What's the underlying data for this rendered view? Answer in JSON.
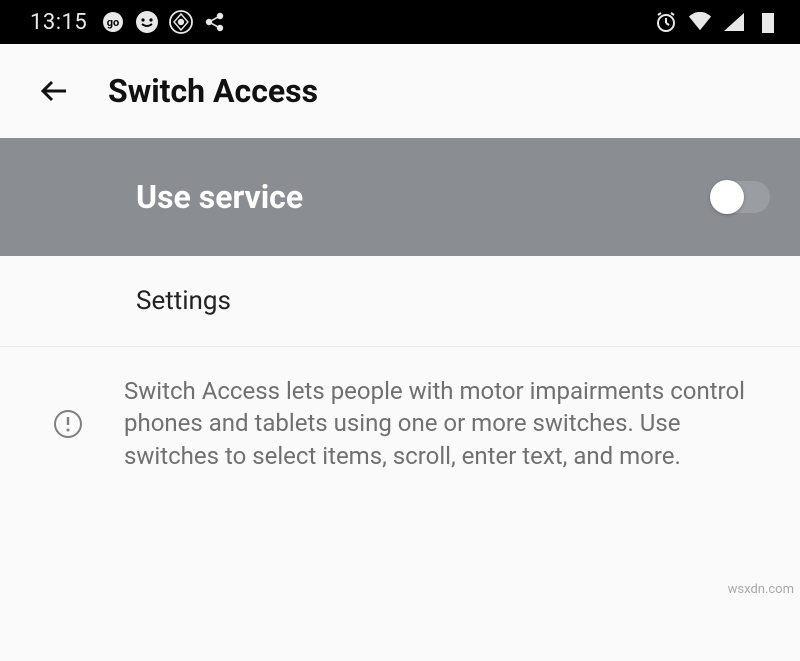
{
  "status_bar": {
    "time": "13:15"
  },
  "header": {
    "title": "Switch Access"
  },
  "use_service": {
    "label": "Use service",
    "enabled": false
  },
  "settings": {
    "label": "Settings"
  },
  "info": {
    "text": "Switch Access lets people with motor impairments control phones and tablets using one or more switches. Use switches to select items, scroll, enter text, and more."
  },
  "watermark": "wsxdn.com"
}
